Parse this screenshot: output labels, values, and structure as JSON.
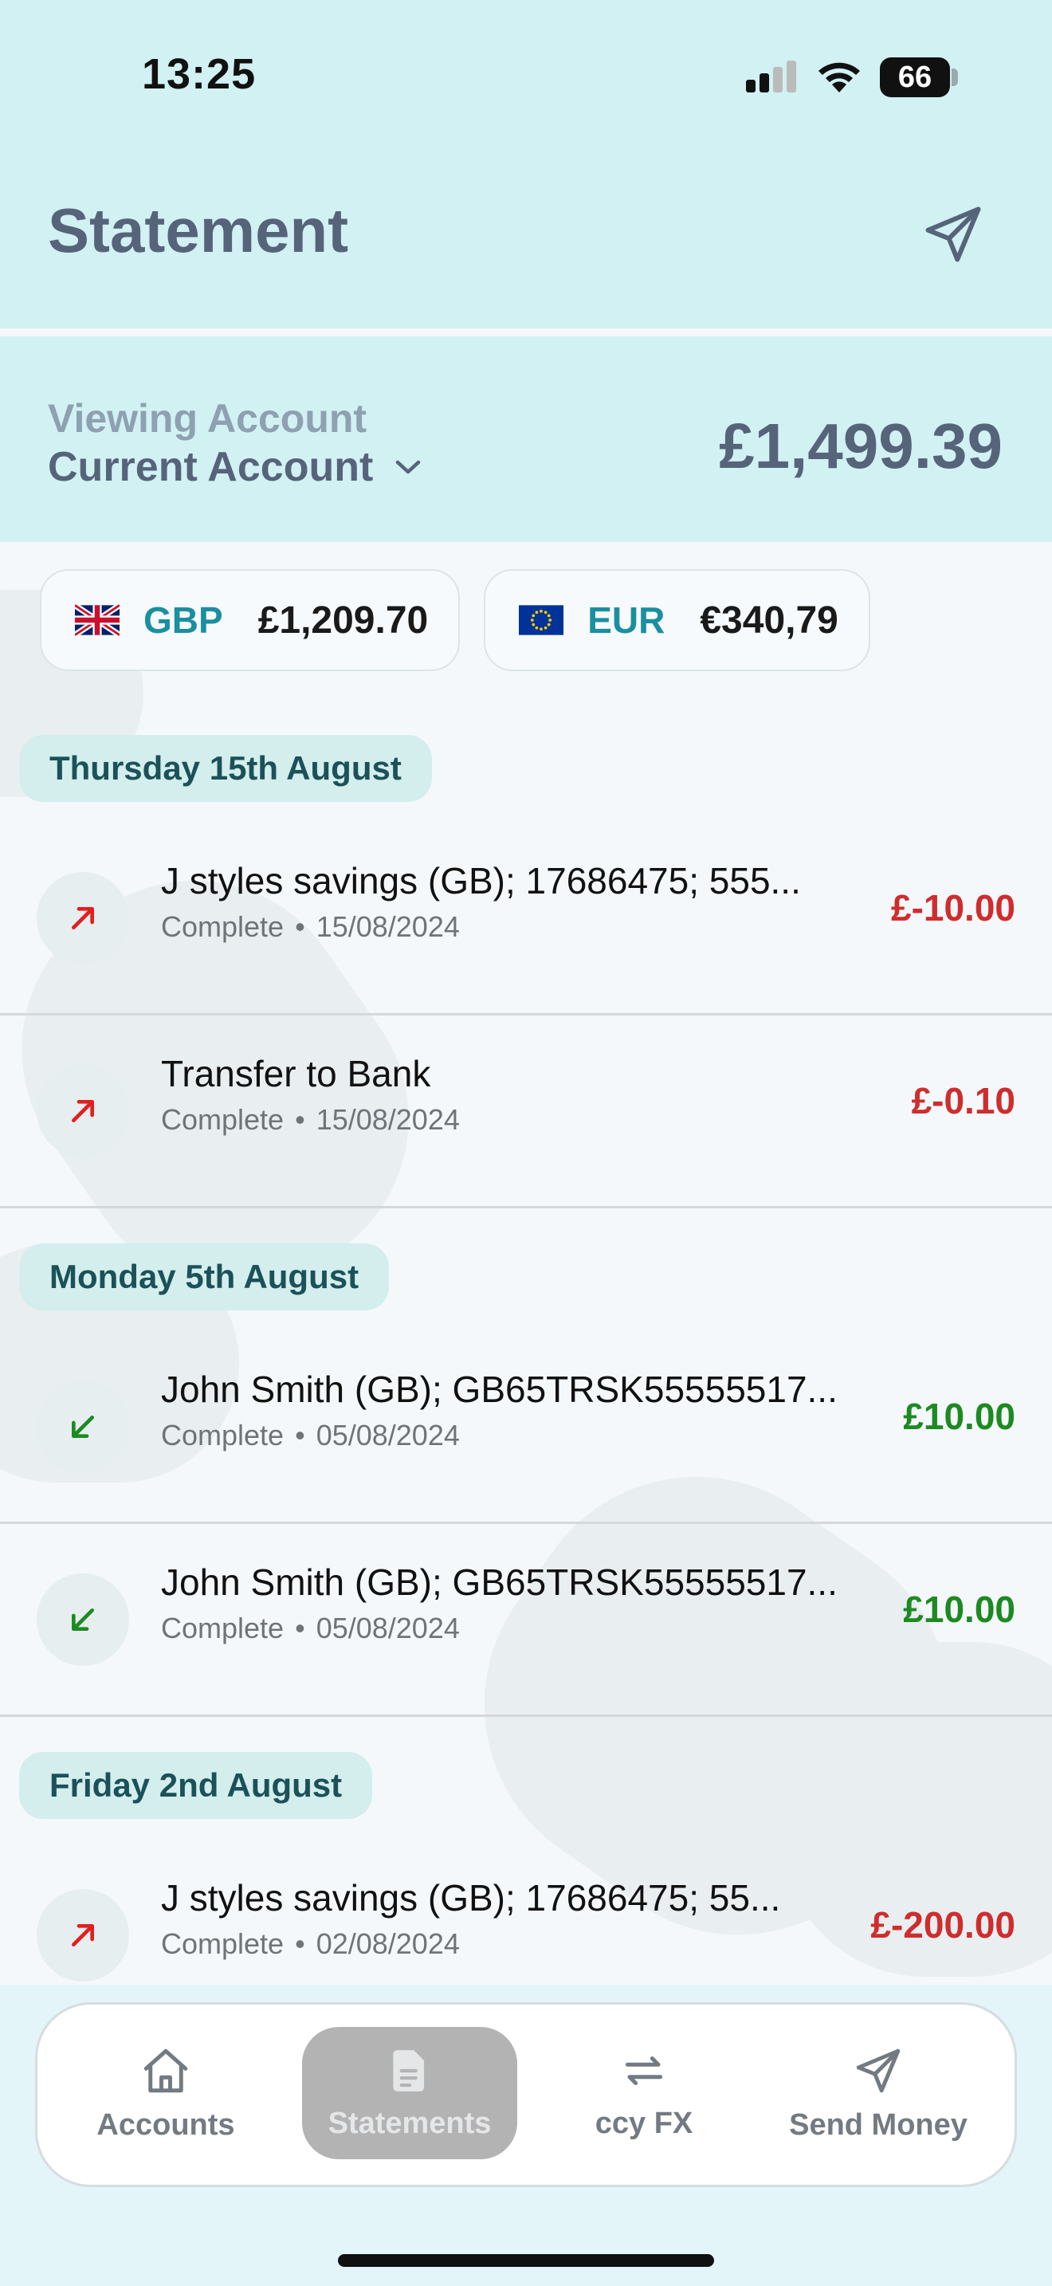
{
  "status_bar": {
    "time": "13:25",
    "battery": "66"
  },
  "header": {
    "title": "Statement"
  },
  "account": {
    "viewing_label": "Viewing Account",
    "name": "Current Account",
    "balance": "£1,499.39"
  },
  "currencies": [
    {
      "code": "GBP",
      "amount": "£1,209.70",
      "flag": "uk-flag"
    },
    {
      "code": "EUR",
      "amount": "€340,79",
      "flag": "eu-flag"
    }
  ],
  "groups": [
    {
      "date": "Thursday 15th August",
      "transactions": [
        {
          "title": "J styles savings (GB); 17686475; 555...",
          "status": "Complete",
          "date": "15/08/2024",
          "amount": "£-10.00",
          "direction": "out"
        },
        {
          "title": "Transfer to Bank",
          "status": "Complete",
          "date": "15/08/2024",
          "amount": "£-0.10",
          "direction": "out"
        }
      ]
    },
    {
      "date": "Monday 5th August",
      "transactions": [
        {
          "title": "John Smith (GB); GB65TRSK55555517...",
          "status": "Complete",
          "date": "05/08/2024",
          "amount": "£10.00",
          "direction": "in"
        },
        {
          "title": "John Smith (GB); GB65TRSK55555517...",
          "status": "Complete",
          "date": "05/08/2024",
          "amount": "£10.00",
          "direction": "in"
        }
      ]
    },
    {
      "date": "Friday 2nd August",
      "transactions": [
        {
          "title": "J styles savings (GB); 17686475; 55...",
          "status": "Complete",
          "date": "02/08/2024",
          "amount": "£-200.00",
          "direction": "out"
        }
      ]
    }
  ],
  "tabs": [
    {
      "label": "Accounts",
      "icon": "home-icon",
      "active": false
    },
    {
      "label": "Statements",
      "icon": "document-icon",
      "active": true
    },
    {
      "label": "ccy FX",
      "icon": "exchange-icon",
      "active": false
    },
    {
      "label": "Send Money",
      "icon": "send-icon",
      "active": false
    }
  ],
  "colors": {
    "header_bg": "#d1f1f3",
    "negative": "#cf2d2d",
    "positive": "#1d8a21",
    "accent": "#1a8fa0"
  }
}
